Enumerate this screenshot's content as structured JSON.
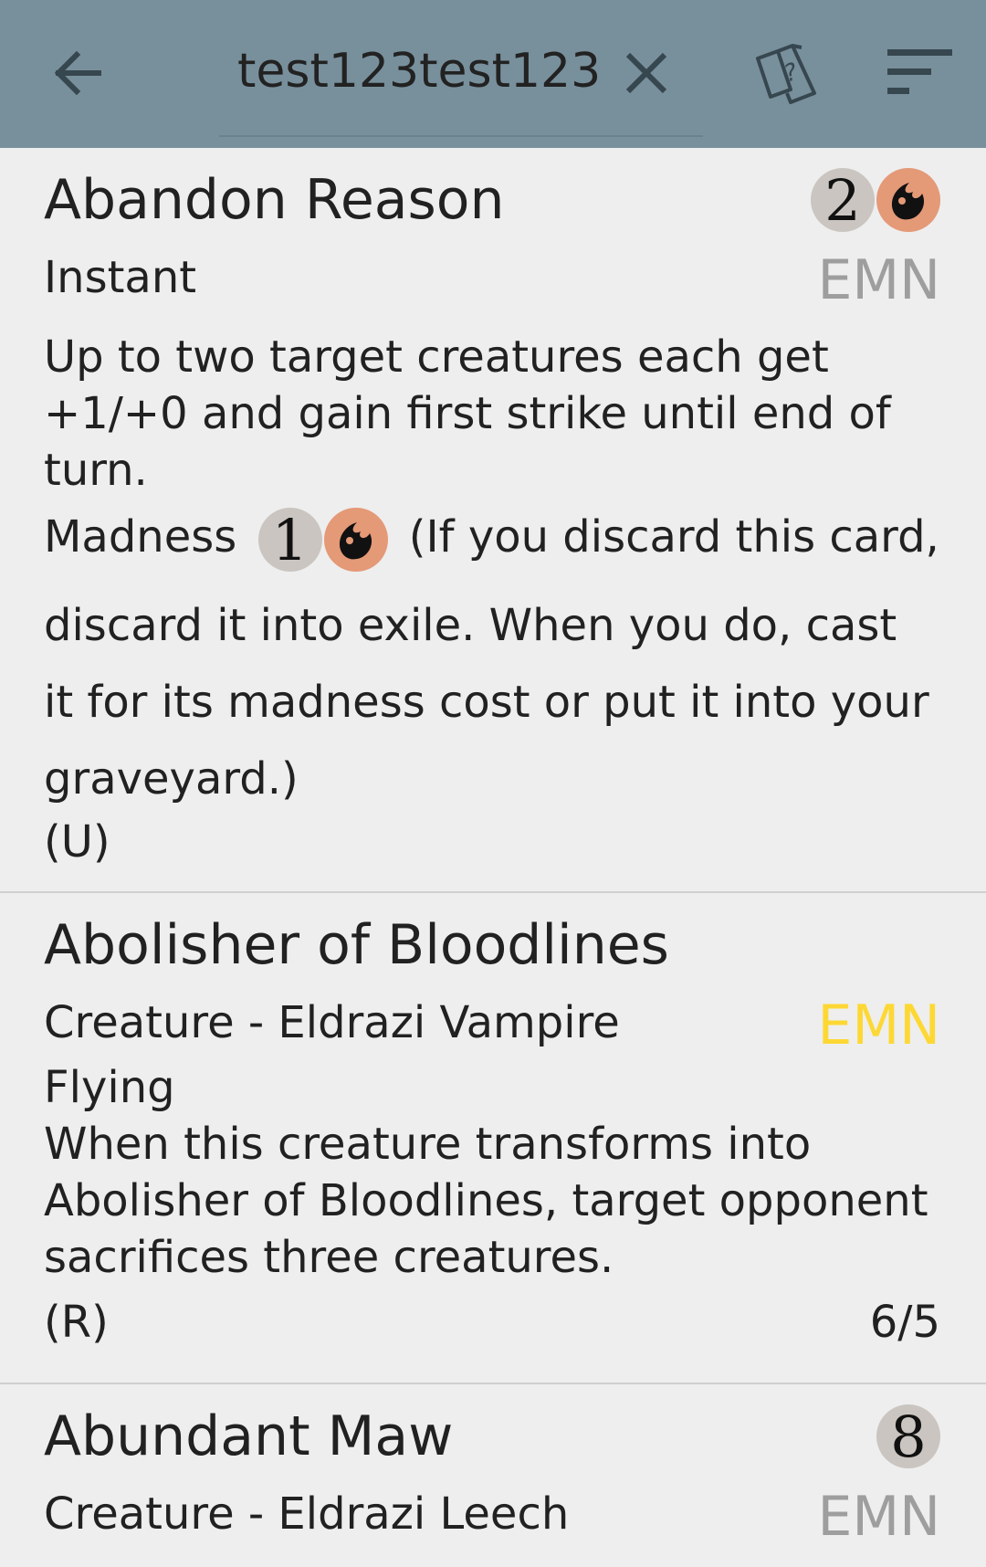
{
  "toolbar": {
    "search_value": "test123test123",
    "back_icon": "arrow-left-icon",
    "clear_icon": "close-icon",
    "cards_icon": "cards-question-icon",
    "sort_icon": "sort-icon"
  },
  "colors": {
    "toolbar_bg": "#78909c",
    "list_bg": "#eeeeee",
    "rare_set_color": "#fdd835",
    "uncommon_set_color": "#9e9e9e",
    "red_mana": "#e49977",
    "generic_mana": "#cac5c0"
  },
  "cards": [
    {
      "name": "Abandon Reason",
      "mana_cost": [
        "2",
        "R"
      ],
      "type": "Instant",
      "set": "EMN",
      "rules_line1": "Up to two target creatures each get",
      "rules_line2": "+1/+0 and gain first strike until end of",
      "rules_line3": "turn.",
      "madness_label": "Madness",
      "madness_cost": [
        "1",
        "R"
      ],
      "madness_text1": "(If you discard this card,",
      "madness_text2": "discard it into exile. When you do, cast",
      "madness_text3": "it for its madness cost or put it into your",
      "madness_text4": "graveyard.)",
      "rarity": "(U)"
    },
    {
      "name": "Abolisher of Bloodlines",
      "type": "Creature - Eldrazi Vampire",
      "set": "EMN",
      "rules_line1": "Flying",
      "rules_line2": "When this creature transforms into",
      "rules_line3": "Abolisher of Bloodlines, target opponent",
      "rules_line4": "sacrifices three creatures.",
      "rarity": "(R)",
      "pt": "6/5"
    },
    {
      "name": "Abundant Maw",
      "mana_cost": [
        "8"
      ],
      "type": "Creature - Eldrazi Leech",
      "set": "EMN"
    }
  ]
}
